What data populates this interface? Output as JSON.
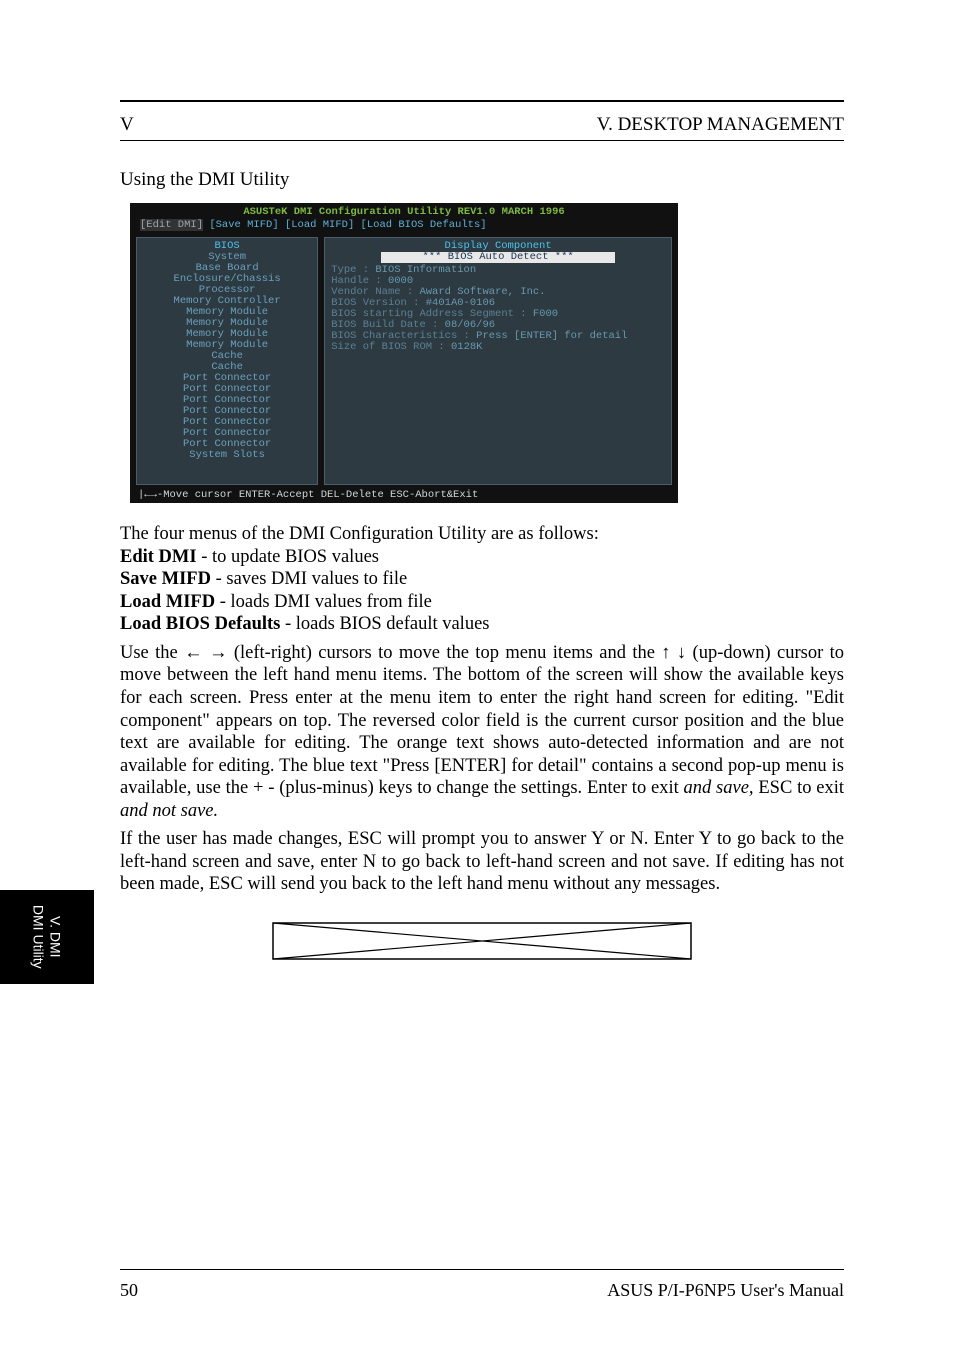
{
  "header": {
    "roman": "V",
    "title": "V. DESKTOP MANAGEMENT"
  },
  "util_heading": "Using the DMI Utility",
  "screenshot": {
    "title": "ASUSTeK DMI Configuration Utility  REV1.0   MARCH 1996",
    "menu": {
      "selected": "[Edit DMI]",
      "items_rest": " [Save MIFD] [Load MIFD] [Load BIOS Defaults]"
    },
    "left_items": [
      "BIOS",
      "System",
      "Base Board",
      "Enclosure/Chassis",
      "Processor",
      "Memory Controller",
      "Memory Module",
      "Memory Module",
      "Memory Module",
      "Memory Module",
      "Cache",
      "Cache",
      "Port Connector",
      "Port Connector",
      "Port Connector",
      "Port Connector",
      "Port Connector",
      "Port Connector",
      "Port Connector",
      "System Slots"
    ],
    "right": {
      "banner1": "Display Component",
      "banner2": "*** BIOS Auto Detect ***",
      "lines": [
        {
          "label": "Type",
          "value": "BIOS Information"
        },
        {
          "label": "Handle",
          "value": "0000"
        },
        {
          "label": "Vendor Name",
          "value": "Award Software, Inc."
        },
        {
          "label": "BIOS Version",
          "value": "#401A0-0106"
        },
        {
          "label": "BIOS starting Address Segment",
          "value": "F000"
        },
        {
          "label": "BIOS Build Date",
          "value": "08/06/96"
        },
        {
          "label": "BIOS Characteristics",
          "value": "Press [ENTER] for detail"
        },
        {
          "label": "Size of BIOS ROM",
          "value": "0128K"
        }
      ]
    },
    "foot": "|←→-Move cursor ENTER-Accept DEL-Delete ESC-Abort&Exit"
  },
  "body": {
    "p1a": "The four menus of the DMI Configuration Utility are as follows:",
    "e1": "Edit DMI",
    "p1b_1": "- to update BIOS values",
    "e2": "Save MIFD",
    "p1b_2": "- saves DMI values to file",
    "e3": "Load MIFD",
    "p1b_3": "- loads DMI values from file",
    "e4": "Load BIOS Defaults",
    "p1b_4": "- loads BIOS default values",
    "p2a": "Use the ← → (left-right) cursors to move the top menu items and the ↑ ↓ (up-down) cursor to move between the left hand menu items. The bottom of the screen will show the available keys for each screen. Press enter at the menu item to enter the right hand screen for editing. \"Edit component\" appears on top. The reversed color field is the current cursor position and the blue text are available for editing. The orange text shows auto-detected information and are not available for editing. The blue text \"Press [ENTER] for detail\" contains a second pop-up menu is available, use the + - (plus-minus) keys to change the settings. Enter to exit ",
    "p2b": "and save, ",
    "p2c": "ESC to exit ",
    "p2d": "and not save.",
    "p3": "If the user has made changes, ESC will prompt you to answer Y or N. Enter Y to go back to the left-hand screen and save, enter N to go back to left-hand screen and not save. If editing has not been made, ESC will send you back to the left hand menu without any messages."
  },
  "sidetab": "V. DMI\nDMI Utility",
  "footer": {
    "left": "50",
    "right": "ASUS P/I-P6NP5 User's Manual"
  }
}
